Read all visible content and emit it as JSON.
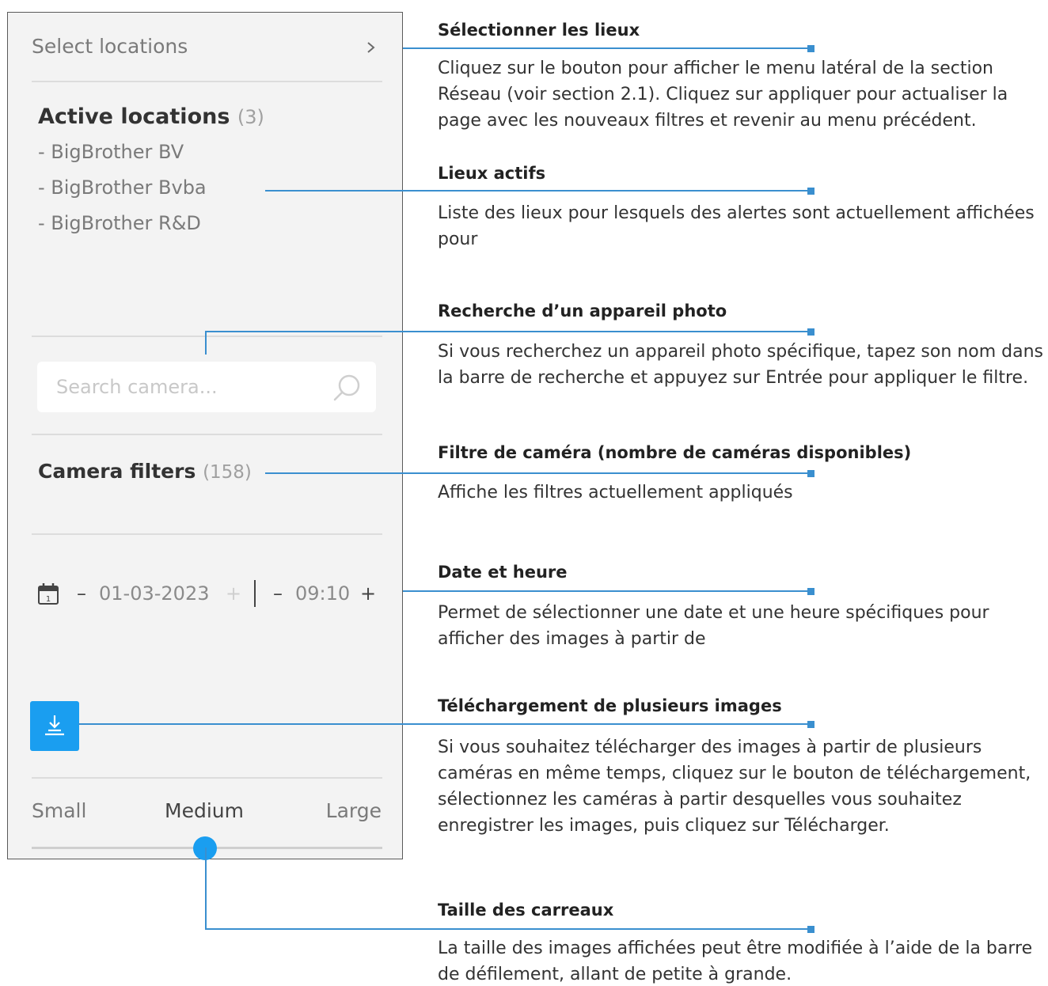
{
  "panel": {
    "select_locations_label": "Select locations",
    "active_locations": {
      "title": "Active locations",
      "count": "(3)",
      "items": [
        "- BigBrother BV",
        "- BigBrother Bvba",
        "- BigBrother R&D"
      ]
    },
    "search": {
      "placeholder": "Search camera..."
    },
    "camera_filters": {
      "title": "Camera filters",
      "count": "(158)"
    },
    "datetime": {
      "minus": "–",
      "plus": "+",
      "date": "01-03-2023",
      "time": "09:10"
    },
    "tile_size": {
      "small": "Small",
      "medium": "Medium",
      "large": "Large",
      "selected": "Medium"
    }
  },
  "annotations": [
    {
      "title": "Sélectionner les lieux",
      "description": "Cliquez sur le bouton pour afficher le menu latéral de la section Réseau (voir section 2.1). Cliquez sur appliquer pour actualiser la page avec les nouveaux filtres et revenir au menu précédent."
    },
    {
      "title": "Lieux actifs",
      "description": "Liste des lieux pour lesquels des alertes sont actuellement affichées pour"
    },
    {
      "title": "Recherche d’un appareil photo",
      "description": "Si vous recherchez un appareil photo spécifique, tapez son nom dans la barre de recherche et appuyez sur Entrée pour appliquer le filtre."
    },
    {
      "title": "Filtre de caméra (nombre de caméras disponibles)",
      "description": "Affiche les filtres actuellement appliqués"
    },
    {
      "title": "Date et heure",
      "description": "Permet de sélectionner une date et une heure spécifiques pour afficher des images à partir de"
    },
    {
      "title": "Téléchargement de plusieurs images",
      "description": "Si vous souhaitez télécharger des images à partir de plusieurs caméras en même temps, cliquez sur le bouton de téléchargement, sélectionnez les caméras à partir desquelles vous souhaitez enregistrer les images, puis cliquez sur Télécharger."
    },
    {
      "title": "Taille des carreaux",
      "description": "La taille des images affichées peut être modifiée à l’aide de la barre de défilement, allant de petite à grande."
    }
  ],
  "colors": {
    "accent": "#1a9ef0",
    "callout_line": "#3a8fcf",
    "panel_bg": "#f3f3f3"
  },
  "icons": [
    "chevron-right-icon",
    "search-icon",
    "calendar-icon",
    "download-icon"
  ]
}
